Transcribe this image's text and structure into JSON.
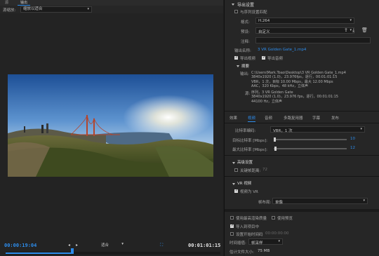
{
  "left": {
    "tabs": [
      "源",
      "输出"
    ],
    "source_scaling": {
      "label": "源缩放:",
      "value": "缩放以适合"
    },
    "timecode_current": "00:00:19:04",
    "timecode_duration": "00:01:01:15",
    "fit_select": "适合",
    "playhead_fraction": 0.31
  },
  "right": {
    "export_settings": {
      "title": "导出设置",
      "match_sequence": "与序列设置匹配",
      "format_label": "格式:",
      "format_value": "H.264",
      "preset_label": "预设:",
      "preset_value": "自定义",
      "comments_label": "注释:",
      "output_name_label": "输出名称:",
      "output_name_value": "3 VR Golden Gate_1.mp4",
      "export_video": "导出视频",
      "export_audio": "导出音频"
    },
    "summary": {
      "title": "摘要",
      "output_label": "输出:",
      "output_lines": [
        "C:\\Users\\Mark.Toao\\Desktop\\3 VR Golden Gate_1.mp4",
        "3840x1920 (1.0)，23.976fps，逐行，00:01:01:15",
        "VBR，1 次，目标 10.00 Mbps，最大 12.00 Mbps",
        "AAC，320 Kbps，48 kHz，立体声"
      ],
      "source_label": "源:",
      "source_lines": [
        "序列，3 VR Golden Gate",
        "3840x1920 (1.0)，23.976 fps，逐行，00:01:01:15",
        "44100 Hz，立体声"
      ]
    },
    "tabs": [
      "效果",
      "视频",
      "音频",
      "多路复用器",
      "字幕",
      "发布"
    ],
    "active_tab": "视频",
    "bitrate": {
      "encoding_label": "比特率编码:",
      "encoding_value": "VBR，1 次",
      "target_label": "目标比特率 [Mbps]:",
      "target_value": "10",
      "max_label": "最大比特率 [Mbps]:",
      "max_value": "12"
    },
    "advanced": {
      "title": "高级设置",
      "keyframe_distance": "关键帧距离:",
      "keyframe_value": "72"
    },
    "vr": {
      "title": "VR 视频",
      "video_is_vr": "视频为 VR",
      "layout_label": "帧布局:",
      "layout_value": "单像"
    },
    "bottom": {
      "max_render_quality": "使用最高渲染质量",
      "use_previews": "使用预览",
      "import_into_project": "导入到项目中",
      "set_start_timecode": "设置开始时间码",
      "start_timecode": "00:00:00:00",
      "interpolation_label": "时间插值:",
      "interpolation_value": "帧采样",
      "file_size_label": "估计文件大小:",
      "file_size_value": "75 MB"
    }
  },
  "colors": {
    "accent": "#2d8ceb",
    "panel": "#262626",
    "background": "#1e1e1e"
  }
}
